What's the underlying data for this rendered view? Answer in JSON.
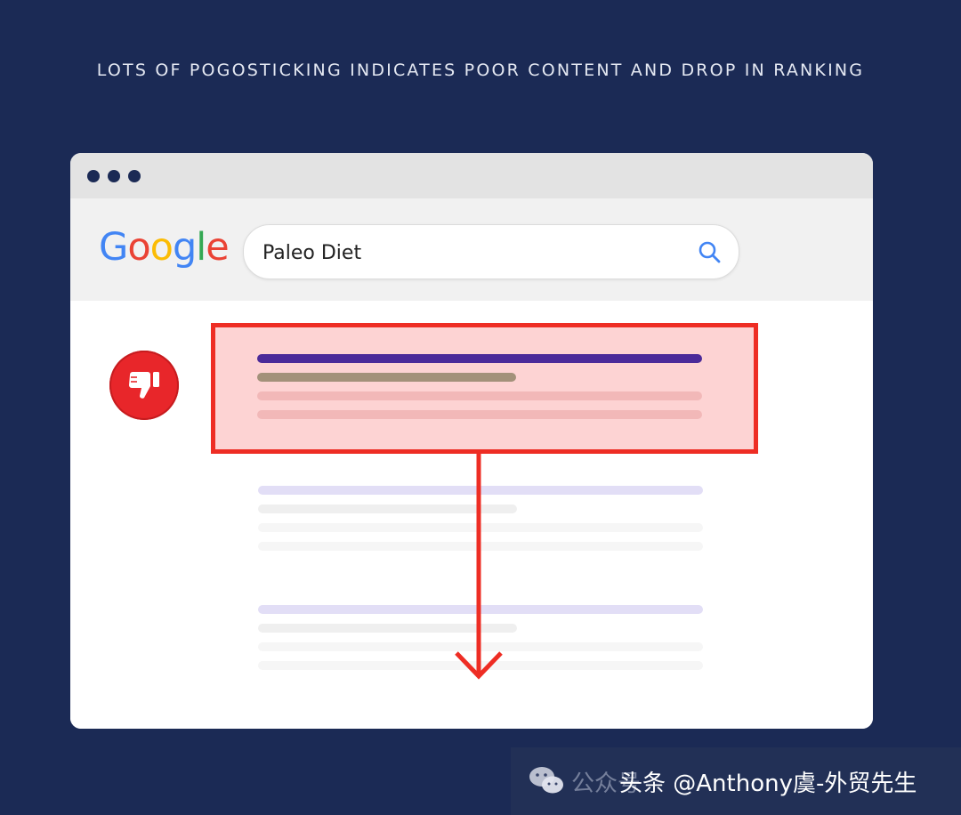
{
  "headline": "LOTS OF POGOSTICKING INDICATES POOR CONTENT AND DROP IN RANKING",
  "logo": {
    "letters": [
      "G",
      "o",
      "o",
      "g",
      "l",
      "e"
    ],
    "colors": [
      "#4285F4",
      "#EA4335",
      "#FBBC05",
      "#4285F4",
      "#34A853",
      "#EA4335"
    ]
  },
  "search": {
    "query": "Paleo Diet",
    "icon": "search-icon"
  },
  "colors": {
    "background": "#1b2a55",
    "highlight_border": "#ee2d24",
    "highlight_fill": "#fdd3d3",
    "title_bar": "#4b2a99",
    "url_bar": "#a3917a",
    "badge": "#e8262a"
  },
  "badge_icon": "thumbs-down-icon",
  "arrow_icon": "arrow-down-icon",
  "watermark": {
    "icon": "wechat-icon",
    "faint_text": "公众号",
    "text": "头条 @Anthony虞-外贸先生"
  }
}
